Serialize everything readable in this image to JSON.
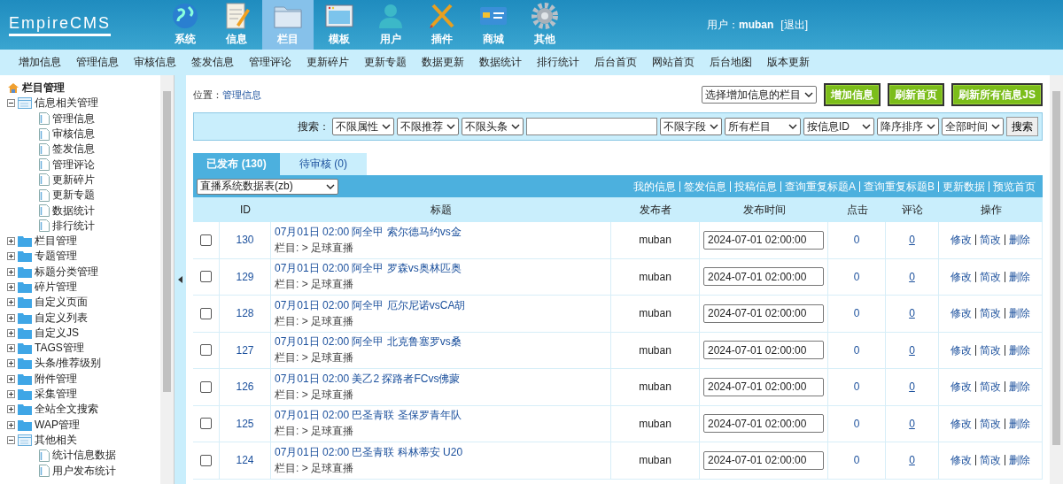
{
  "header": {
    "logo": "EmpireCMS",
    "nav": [
      {
        "label": "系统",
        "kind": "globe",
        "selected": false
      },
      {
        "label": "信息",
        "kind": "notepad",
        "selected": false
      },
      {
        "label": "栏目",
        "kind": "folder",
        "selected": true
      },
      {
        "label": "模板",
        "kind": "window",
        "selected": false
      },
      {
        "label": "用户",
        "kind": "person",
        "selected": false
      },
      {
        "label": "插件",
        "kind": "tools",
        "selected": false
      },
      {
        "label": "商城",
        "kind": "card",
        "selected": false
      },
      {
        "label": "其他",
        "kind": "gear",
        "selected": false
      }
    ],
    "user_label": "用户：",
    "user_name": "muban",
    "logout": "[退出]"
  },
  "subnav": [
    "增加信息",
    "管理信息",
    "审核信息",
    "签发信息",
    "管理评论",
    "更新碎片",
    "更新专题",
    "数据更新",
    "数据统计",
    "排行统计",
    "后台首页",
    "网站首页",
    "后台地图",
    "版本更新"
  ],
  "sidebar": {
    "title": "栏目管理",
    "tree": [
      {
        "label": "信息相关管理",
        "expanded": true,
        "children": [
          {
            "label": "管理信息"
          },
          {
            "label": "审核信息"
          },
          {
            "label": "签发信息"
          },
          {
            "label": "管理评论"
          },
          {
            "label": "更新碎片"
          },
          {
            "label": "更新专题"
          },
          {
            "label": "数据统计"
          },
          {
            "label": "排行统计"
          }
        ]
      },
      {
        "label": "栏目管理",
        "expanded": false
      },
      {
        "label": "专题管理",
        "expanded": false
      },
      {
        "label": "标题分类管理",
        "expanded": false
      },
      {
        "label": "碎片管理",
        "expanded": false
      },
      {
        "label": "自定义页面",
        "expanded": false
      },
      {
        "label": "自定义列表",
        "expanded": false
      },
      {
        "label": "自定义JS",
        "expanded": false
      },
      {
        "label": "TAGS管理",
        "expanded": false
      },
      {
        "label": "头条/推荐级别",
        "expanded": false
      },
      {
        "label": "附件管理",
        "expanded": false
      },
      {
        "label": "采集管理",
        "expanded": false
      },
      {
        "label": "全站全文搜索",
        "expanded": false
      },
      {
        "label": "WAP管理",
        "expanded": false
      },
      {
        "label": "其他相关",
        "expanded": true,
        "children": [
          {
            "label": "统计信息数据"
          },
          {
            "label": "用户发布统计"
          }
        ]
      }
    ]
  },
  "location": {
    "label": "位置：",
    "link": "管理信息"
  },
  "column_select": "选择增加信息的栏目",
  "action_buttons": [
    "增加信息",
    "刷新首页",
    "刷新所有信息JS"
  ],
  "search": {
    "label": "搜索：",
    "filters_before": [
      "不限属性",
      "不限推荐",
      "不限头条"
    ],
    "filters_after": [
      "不限字段",
      "所有栏目",
      "按信息ID",
      "降序排序",
      "全部时间"
    ],
    "button": "搜索"
  },
  "tabs": [
    {
      "label": "已发布 (130)",
      "selected": true
    },
    {
      "label": "待审核 (0)",
      "selected": false
    }
  ],
  "table_select": "直播系统数据表(zb)",
  "table_links": [
    "我的信息",
    "签发信息",
    "投稿信息",
    "查询重复标题A",
    "查询重复标题B",
    "更新数据",
    "预览首页"
  ],
  "table": {
    "columns": [
      "ID",
      "标题",
      "发布者",
      "发布时间",
      "点击",
      "评论",
      "操作"
    ],
    "rows": [
      {
        "checked": false,
        "id": "130",
        "title": "07月01日 02:00 阿全甲 索尔德马约vs金",
        "category": "栏目: > 足球直播",
        "author": "muban",
        "time": "2024-07-01 02:00:00",
        "clicks": "0",
        "comments": "0",
        "actions": [
          "修改",
          "简改",
          "删除"
        ]
      },
      {
        "checked": false,
        "id": "129",
        "title": "07月01日 02:00 阿全甲 罗森vs奥林匹奥",
        "category": "栏目: > 足球直播",
        "author": "muban",
        "time": "2024-07-01 02:00:00",
        "clicks": "0",
        "comments": "0",
        "actions": [
          "修改",
          "简改",
          "删除"
        ]
      },
      {
        "checked": false,
        "id": "128",
        "title": "07月01日 02:00 阿全甲 厄尔尼诺vsCA胡",
        "category": "栏目: > 足球直播",
        "author": "muban",
        "time": "2024-07-01 02:00:00",
        "clicks": "0",
        "comments": "0",
        "actions": [
          "修改",
          "简改",
          "删除"
        ]
      },
      {
        "checked": false,
        "id": "127",
        "title": "07月01日 02:00 阿全甲 北克鲁塞罗vs桑",
        "category": "栏目: > 足球直播",
        "author": "muban",
        "time": "2024-07-01 02:00:00",
        "clicks": "0",
        "comments": "0",
        "actions": [
          "修改",
          "简改",
          "删除"
        ]
      },
      {
        "checked": false,
        "id": "126",
        "title": "07月01日 02:00 美乙2 探路者FCvs佛蒙",
        "category": "栏目: > 足球直播",
        "author": "muban",
        "time": "2024-07-01 02:00:00",
        "clicks": "0",
        "comments": "0",
        "actions": [
          "修改",
          "简改",
          "删除"
        ]
      },
      {
        "checked": false,
        "id": "125",
        "title": "07月01日 02:00 巴圣青联 圣保罗青年队",
        "category": "栏目: > 足球直播",
        "author": "muban",
        "time": "2024-07-01 02:00:00",
        "clicks": "0",
        "comments": "0",
        "actions": [
          "修改",
          "简改",
          "删除"
        ]
      },
      {
        "checked": false,
        "id": "124",
        "title": "07月01日 02:00 巴圣青联 科林蒂安 U20",
        "category": "栏目: > 足球直播",
        "author": "muban",
        "time": "2024-07-01 02:00:00",
        "clicks": "0",
        "comments": "0",
        "actions": [
          "修改",
          "简改",
          "删除"
        ]
      }
    ]
  }
}
